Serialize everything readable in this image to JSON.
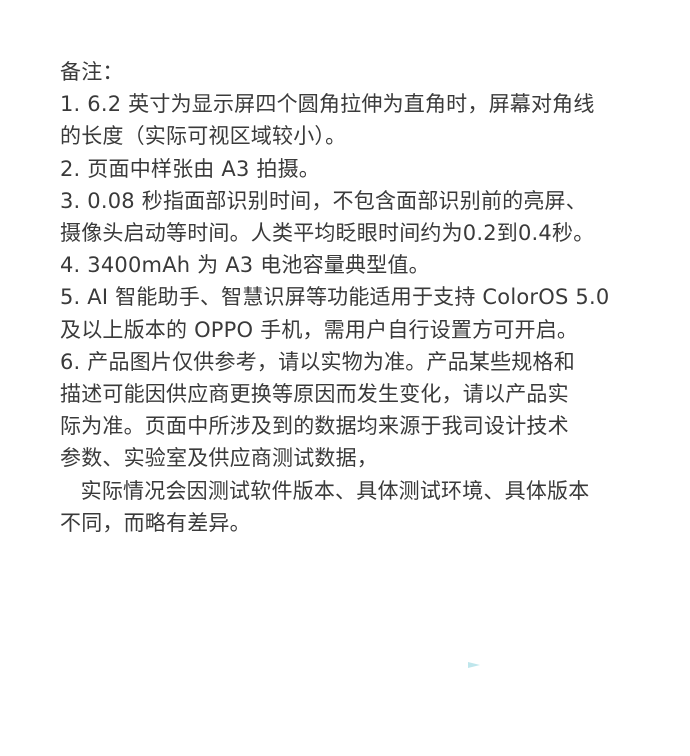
{
  "notes": {
    "heading": "备注：",
    "lines": [
      "1. 6.2 英寸为显示屏四个圆角拉伸为直角时，屏幕对角线",
      "的长度（实际可视区域较小）。",
      "2. 页面中样张由 A3 拍摄。",
      "3. 0.08 秒指面部识别时间，不包含面部识别前的亮屏、",
      "摄像头启动等时间。人类平均眨眼时间约为0.2到0.4秒。",
      "4. 3400mAh 为 A3 电池容量典型值。",
      "5. AI 智能助手、智慧识屏等功能适用于支持 ColorOS 5.0",
      "及以上版本的 OPPO 手机，需用户自行设置方可开启。",
      "6. 产品图片仅供参考，请以实物为准。产品某些规格和",
      "描述可能因供应商更换等原因而发生变化，请以产品实",
      "际为准。页面中所涉及到的数据均来源于我司设计技术",
      "参数、实验室及供应商测试数据，",
      "   实际情况会因测试软件版本、具体测试环境、具体版本",
      "不同，而略有差异。"
    ]
  },
  "colors": {
    "text": "#3a3a3a",
    "background": "#ffffff",
    "mark": "#bfe6ec"
  }
}
